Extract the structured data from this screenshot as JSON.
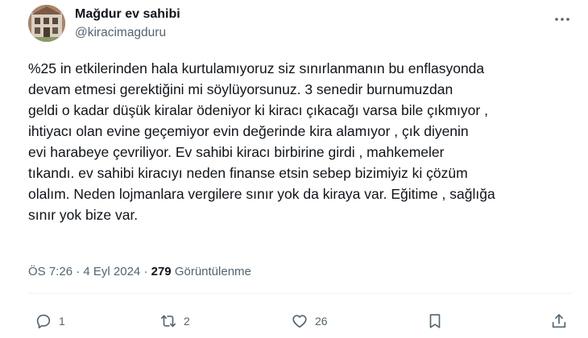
{
  "author": {
    "display_name": "Mağdur ev sahibi",
    "handle": "@kiracimagduru"
  },
  "tweet": {
    "text": "%25 in etkilerinden hala kurtulamıyoruz siz sınırlanmanın bu enflasyonda\ndevam etmesi gerektiğini mi söylüyorsunuz. 3 senedir burnumuzdan\ngeldi o kadar düşük kiralar ödeniyor ki kiracı çıkacağı varsa bile çıkmıyor ,\nihtiyacı olan evine geçemiyor evin değerinde kira alamıyor , çık diyenin\nevi harabeye çevriliyor. Ev sahibi kiracı birbirine girdi , mahkemeler\ntıkandı. ev sahibi kiracıyı neden finanse etsin sebep bizimiyiz ki çözüm\nolalım. Neden lojmanlara vergilere sınır yok da kiraya var. Eğitime , sağlığa\nsınır yok bize var."
  },
  "meta": {
    "time": "ÖS 7:26",
    "separator": "·",
    "date": "4 Eyl 2024",
    "views_count": "279",
    "views_label": "Görüntülenme"
  },
  "actions": {
    "reply_count": "1",
    "retweet_count": "2",
    "like_count": "26"
  },
  "icons": {
    "more": "more-horizontal-icon",
    "reply": "reply-icon",
    "retweet": "retweet-icon",
    "like": "heart-icon",
    "bookmark": "bookmark-icon",
    "share": "share-icon"
  },
  "colors": {
    "text": "#0f1419",
    "secondary_text": "#536471",
    "divider": "#eff3f4"
  }
}
